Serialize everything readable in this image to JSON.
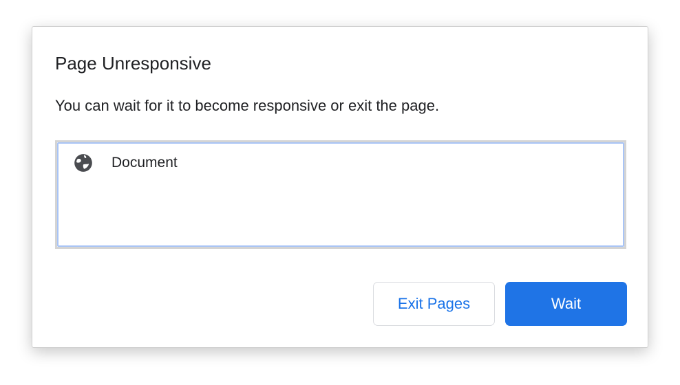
{
  "dialog": {
    "title": "Page Unresponsive",
    "message": "You can wait for it to become responsive or exit the page.",
    "pages": [
      {
        "label": "Document",
        "icon": "globe-icon"
      }
    ],
    "buttons": {
      "exit_label": "Exit Pages",
      "wait_label": "Wait"
    },
    "colors": {
      "accent": "#1f74e6",
      "focus_ring": "#a8c4f6"
    }
  }
}
